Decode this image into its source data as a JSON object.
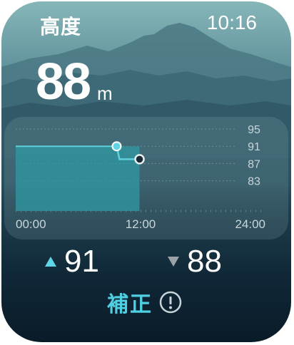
{
  "status": {
    "title": "高度",
    "time": "10:16"
  },
  "altitude": {
    "value": "88",
    "unit": "m"
  },
  "chart_data": {
    "type": "area",
    "xlabel": "",
    "ylabel": "",
    "x_ticks": [
      "00:00",
      "12:00",
      "24:00"
    ],
    "y_ticks": [
      95,
      91,
      87,
      83
    ],
    "xlim": [
      0,
      24
    ],
    "ylim": [
      77,
      97
    ],
    "series": [
      {
        "x": [
          0,
          9.7,
          10.0,
          11.9
        ],
        "y": [
          91,
          91,
          88,
          88
        ]
      }
    ],
    "points": [
      {
        "x": 9.7,
        "y": 91,
        "kind": "max"
      },
      {
        "x": 11.9,
        "y": 88,
        "kind": "current"
      }
    ],
    "colors": {
      "area": "#2e9aa3",
      "line": "#5fd0dc",
      "max_marker": "#5fd6e6",
      "current_marker": "#1a2a34"
    }
  },
  "stats": {
    "max": {
      "icon": "triangle-up-icon",
      "value": "91",
      "color": "#5fd6e6"
    },
    "min": {
      "icon": "triangle-down-icon",
      "value": "88",
      "color": "#9aa3a8"
    }
  },
  "calibrate": {
    "label": "補正",
    "icon": "info-icon",
    "color": "#4fd0e2"
  }
}
